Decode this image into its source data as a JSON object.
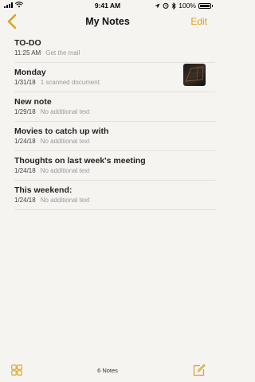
{
  "status": {
    "time": "9:41 AM",
    "battery_percent": "100%",
    "battery_level": 1.0,
    "icons": [
      "signal-icon",
      "wifi-icon",
      "location-icon",
      "alarm-icon",
      "bluetooth-icon",
      "battery-icon"
    ]
  },
  "nav": {
    "title": "My Notes",
    "edit_label": "Edit",
    "back_icon": "chevron-left-icon"
  },
  "notes": [
    {
      "title": "TO-DO",
      "date": "11:25 AM",
      "preview": "Get the mail"
    },
    {
      "title": "Monday",
      "date": "1/31/18",
      "preview": "1 scanned document",
      "thumbnail": "scanned-document-thumbnail"
    },
    {
      "title": "New note",
      "date": "1/29/18",
      "preview": "No additional text"
    },
    {
      "title": "Movies to catch up with",
      "date": "1/24/18",
      "preview": "No additional text"
    },
    {
      "title": "Thoughts on last week's meeting",
      "date": "1/24/18",
      "preview": "No additional text"
    },
    {
      "title": "This weekend:",
      "date": "1/24/18",
      "preview": "No additional text"
    }
  ],
  "toolbar": {
    "count_label": "6 Notes",
    "left_icon": "gallery-grid-icon",
    "right_icon": "compose-icon"
  },
  "colors": {
    "accent": "#d9a21b",
    "background": "#f5f4f1"
  }
}
